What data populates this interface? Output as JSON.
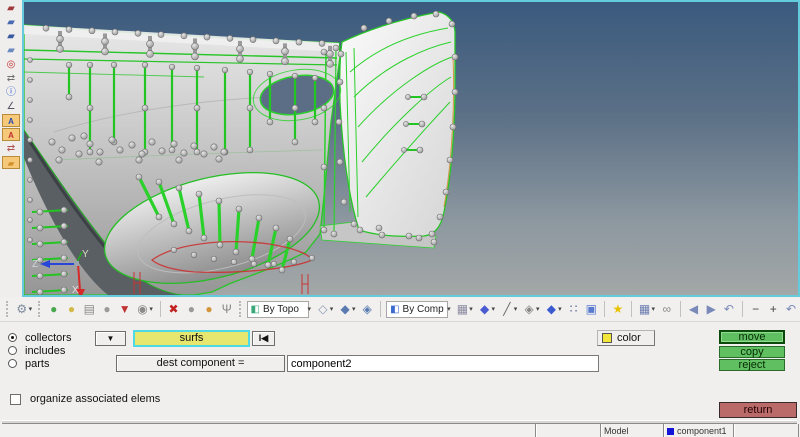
{
  "viewport": {
    "axis_labels": {
      "z": "Z",
      "y": "Y",
      "x": "X"
    }
  },
  "left_toolbar": {
    "icons": [
      {
        "name": "view-orientation-icon",
        "glyph": "▰",
        "color": "#a03a3a"
      },
      {
        "name": "shaded-plate-icon",
        "glyph": "▰",
        "color": "#4a6ab0"
      },
      {
        "name": "wireframe-plate-icon",
        "glyph": "▰",
        "color": "#3a5aa0"
      },
      {
        "name": "plate-outline-icon",
        "glyph": "▰",
        "color": "#6a8ac0"
      },
      {
        "name": "clipping-off-icon",
        "glyph": "◎",
        "color": "#c03030"
      },
      {
        "name": "vector-display-icon",
        "glyph": "⇄",
        "color": "#707070"
      },
      {
        "name": "numbers-info-icon",
        "glyph": "ⓘ",
        "color": "#2a5ad0"
      },
      {
        "name": "measure-angle-icon",
        "glyph": "∠",
        "color": "#556"
      },
      {
        "name": "label-abc-blue-icon",
        "glyph": "A",
        "color": "#2a4ab0",
        "boxed": true
      },
      {
        "name": "label-abc-red-icon",
        "glyph": "A",
        "color": "#c03030",
        "boxed": true
      },
      {
        "name": "entity-arrows-icon",
        "glyph": "⇄",
        "color": "#b05050"
      },
      {
        "name": "orange-plate-icon",
        "glyph": "▰",
        "color": "#d0902a",
        "boxed": true
      }
    ]
  },
  "display_toolbar": {
    "items": [
      {
        "type": "grip"
      },
      {
        "type": "icon",
        "name": "display-options-gear-icon",
        "glyph": "⚙",
        "color": "#7a8a9a",
        "dropdown": true
      },
      {
        "type": "grip"
      },
      {
        "type": "icon",
        "name": "mask-entities-icon",
        "glyph": "●",
        "color": "#49a84e"
      },
      {
        "type": "icon",
        "name": "unmask-entities-icon",
        "glyph": "●",
        "color": "#d2b948"
      },
      {
        "type": "icon",
        "name": "mask-panel-icon",
        "glyph": "▤",
        "color": "#8a8a8a"
      },
      {
        "type": "icon",
        "name": "unmask-adjacent-icon",
        "glyph": "●",
        "color": "#9a9a9a"
      },
      {
        "type": "icon",
        "name": "mask-reverse-icon",
        "glyph": "▼",
        "color": "#c23333"
      },
      {
        "type": "icon",
        "name": "find-entities-icon",
        "glyph": "◉",
        "color": "#8a8a8a",
        "dropdown": true
      },
      {
        "type": "sep"
      },
      {
        "type": "icon",
        "name": "delete-entities-icon",
        "glyph": "✖",
        "color": "#c22222"
      },
      {
        "type": "icon",
        "name": "spheres-display-icon",
        "glyph": "●",
        "color": "#9a9a9a"
      },
      {
        "type": "icon",
        "name": "spheres-highlight-icon",
        "glyph": "●",
        "color": "#d2953a"
      },
      {
        "type": "icon",
        "name": "connector-tree-icon",
        "glyph": "Ψ",
        "color": "#888"
      },
      {
        "type": "grip"
      },
      {
        "type": "combo",
        "name": "geometry-color-mode-select",
        "label": "By Topo",
        "glyph": "◧",
        "color": "#3aa878",
        "dropdown": true
      },
      {
        "type": "icon",
        "name": "wireframe-geometry-icon",
        "glyph": "◇",
        "color": "#8a9ab0",
        "dropdown": true
      },
      {
        "type": "icon",
        "name": "shaded-geometry-icon",
        "glyph": "◆",
        "color": "#5a7ab0",
        "dropdown": true
      },
      {
        "type": "icon",
        "name": "shaded-geometry-edges-icon",
        "glyph": "◈",
        "color": "#5a7ab0"
      },
      {
        "type": "sep"
      },
      {
        "type": "combo",
        "name": "element-color-mode-select",
        "label": "By Comp",
        "glyph": "◧",
        "color": "#3a6ad0",
        "dropdown": true
      },
      {
        "type": "icon",
        "name": "wireframe-elements-icon",
        "glyph": "▦",
        "color": "#8a8aa0",
        "dropdown": true
      },
      {
        "type": "icon",
        "name": "shaded-elements-icon",
        "glyph": "◆",
        "color": "#4a5ad0",
        "dropdown": true
      },
      {
        "type": "icon",
        "name": "feature-lines-icon",
        "glyph": "╱",
        "color": "#666",
        "dropdown": true
      },
      {
        "type": "icon",
        "name": "shaded-features-icon",
        "glyph": "◈",
        "color": "#888",
        "dropdown": true
      },
      {
        "type": "icon",
        "name": "element-handles-icon",
        "glyph": "◆",
        "color": "#3a5ad0",
        "dropdown": true
      },
      {
        "type": "icon",
        "name": "visualization-cluster-icon",
        "glyph": "∷",
        "color": "#5a6a9a"
      },
      {
        "type": "icon",
        "name": "performance-monitor-icon",
        "glyph": "▣",
        "color": "#5a7ad0"
      },
      {
        "type": "sep"
      },
      {
        "type": "icon",
        "name": "favorites-star-icon",
        "glyph": "★",
        "color": "#e8c200"
      },
      {
        "type": "sep"
      },
      {
        "type": "icon",
        "name": "panels-grid-icon",
        "glyph": "▦",
        "color": "#6a7ab0",
        "dropdown": true
      },
      {
        "type": "icon",
        "name": "link-dogbone-icon",
        "glyph": "∞",
        "color": "#8a8a8a"
      },
      {
        "type": "sep"
      },
      {
        "type": "icon",
        "name": "nav-back-icon",
        "glyph": "◀",
        "color": "#7a8ab8"
      },
      {
        "type": "icon",
        "name": "nav-forward-icon",
        "glyph": "▶",
        "color": "#7a8ab8"
      },
      {
        "type": "icon",
        "name": "undo-view-icon",
        "glyph": "↶",
        "color": "#7a8ab8"
      },
      {
        "type": "sep"
      },
      {
        "type": "icon",
        "name": "zoom-out-icon",
        "glyph": "−",
        "color": "#444"
      },
      {
        "type": "icon",
        "name": "zoom-in-icon",
        "glyph": "+",
        "color": "#444"
      },
      {
        "type": "icon",
        "name": "reset-view-icon",
        "glyph": "↶",
        "color": "#7a8ab8"
      }
    ]
  },
  "panel": {
    "radios": [
      {
        "label": "collectors",
        "selected": true
      },
      {
        "label": "includes",
        "selected": false
      },
      {
        "label": "parts",
        "selected": false
      }
    ],
    "entity_dropdown_glyph": "▼",
    "entity_field_value": "surfs",
    "switch_button_glyph": "I◀",
    "dest_label": "dest component =",
    "dest_value": "component2",
    "color_button": {
      "label": "color",
      "swatch_color": "#f2e63a"
    },
    "action_buttons": {
      "move": "move",
      "copy": "copy",
      "reject": "reject"
    },
    "organize_checkbox_label": "organize associated elems",
    "return_label": "return"
  },
  "status_bar": {
    "model_cell": "Model",
    "component_cell": "component1",
    "component_color": "#1414d8"
  }
}
